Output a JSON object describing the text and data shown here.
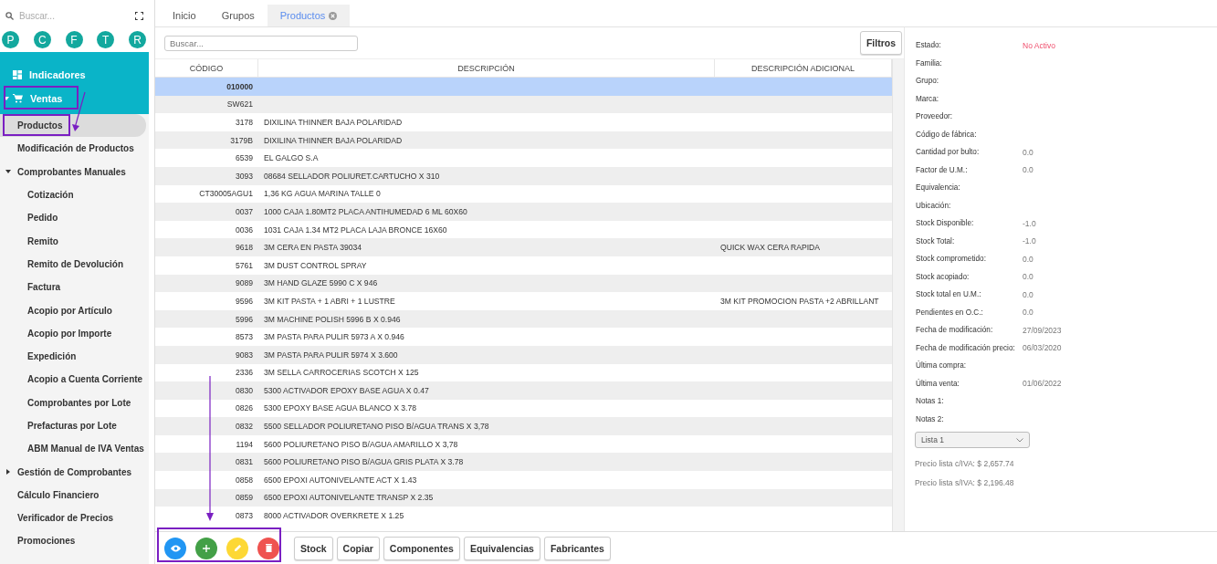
{
  "sidebar": {
    "search": {
      "placeholder": "Buscar..."
    },
    "shortcuts": [
      "P",
      "C",
      "F",
      "T",
      "R"
    ],
    "menu": [
      {
        "label": "Indicadores",
        "selected": false
      },
      {
        "label": "Ventas",
        "expanded": true,
        "selected": false,
        "children": [
          {
            "label": "Productos",
            "selected": true
          },
          {
            "label": "Modificación de Productos",
            "selected": false
          },
          {
            "label": "Comprobantes Manuales",
            "expanded": true,
            "selected": false,
            "children": [
              {
                "label": "Cotización",
                "selected": false
              },
              {
                "label": "Pedido",
                "selected": false
              },
              {
                "label": "Remito",
                "selected": false
              },
              {
                "label": "Remito de Devolución",
                "selected": false
              },
              {
                "label": "Factura",
                "selected": false
              },
              {
                "label": "Acopio por Artículo",
                "selected": false
              },
              {
                "label": "Acopio por Importe",
                "selected": false
              },
              {
                "label": "Expedición",
                "selected": false
              },
              {
                "label": "Acopio a Cuenta Corriente",
                "selected": false
              },
              {
                "label": "Comprobantes por Lote",
                "selected": false
              },
              {
                "label": "Prefacturas por Lote",
                "selected": false
              },
              {
                "label": "ABM Manual de IVA Ventas",
                "selected": false
              }
            ]
          },
          {
            "label": "Gestión de Comprobantes",
            "expanded": false,
            "selected": false
          },
          {
            "label": "Cálculo Financiero",
            "selected": false
          },
          {
            "label": "Verificador de Precios",
            "selected": false
          },
          {
            "label": "Promociones",
            "selected": false
          }
        ]
      }
    ]
  },
  "tabs": [
    {
      "label": "Inicio",
      "selected": false,
      "closable": false
    },
    {
      "label": "Grupos",
      "selected": false,
      "closable": false
    },
    {
      "label": "Productos",
      "selected": true,
      "closable": true
    }
  ],
  "search": {
    "placeholder": "Buscar..."
  },
  "filters_button": "Filtros",
  "table": {
    "columns": [
      "CÓDIGO",
      "DESCRIPCIÓN",
      "DESCRIPCIÓN ADICIONAL"
    ],
    "rows": [
      {
        "code": "010000",
        "selected": true
      },
      {
        "code": "SW621",
        "selected": false
      },
      {
        "code": "3178",
        "description": "DIXILINA THINNER BAJA POLARIDAD",
        "selected": false
      },
      {
        "code": "3179B",
        "description": "DIXILINA THINNER BAJA POLARIDAD",
        "selected": false
      },
      {
        "code": "6539",
        "description": "EL GALGO S.A",
        "selected": false
      },
      {
        "code": "3093",
        "description": "08684 SELLADOR POLIURET.CARTUCHO X 310",
        "selected": false
      },
      {
        "code": "CT30005AGU1",
        "description": "1,36 KG AGUA MARINA TALLE 0",
        "selected": false
      },
      {
        "code": "0037",
        "description": "1000 CAJA 1.80MT2 PLACA ANTIHUMEDAD 6 ML 60X60",
        "selected": false
      },
      {
        "code": "0036",
        "description": "1031 CAJA 1.34 MT2 PLACA LAJA BRONCE 16X60",
        "selected": false
      },
      {
        "code": "9618",
        "description": "3M CERA EN PASTA 39034",
        "extra": "QUICK WAX CERA RAPIDA",
        "selected": false
      },
      {
        "code": "5761",
        "description": "3M DUST CONTROL SPRAY",
        "selected": false
      },
      {
        "code": "9089",
        "description": "3M HAND GLAZE 5990 C X 946",
        "selected": false
      },
      {
        "code": "9596",
        "description": "3M KIT PASTA + 1 ABRI + 1 LUSTRE",
        "extra": "3M KIT PROMOCION PASTA +2 ABRILLANT",
        "selected": false
      },
      {
        "code": "5996",
        "description": "3M MACHINE POLISH 5996 B X 0.946",
        "selected": false
      },
      {
        "code": "8573",
        "description": "3M PASTA PARA PULIR 5973 A X 0.946",
        "selected": false
      },
      {
        "code": "9083",
        "description": "3M PASTA PARA PULIR 5974 X 3.600",
        "selected": false
      },
      {
        "code": "2336",
        "description": "3M SELLA CARROCERIAS SCOTCH X 125",
        "selected": false
      },
      {
        "code": "0830",
        "description": "5300 ACTIVADOR EPOXY BASE AGUA X 0.47",
        "selected": false
      },
      {
        "code": "0826",
        "description": "5300 EPOXY BASE AGUA BLANCO X 3.78",
        "selected": false
      },
      {
        "code": "0832",
        "description": "5500 SELLADOR POLIURETANO PISO B/AGUA TRANS X 3,78",
        "selected": false
      },
      {
        "code": "1194",
        "description": "5600 POLIURETANO PISO B/AGUA AMARILLO X 3,78",
        "selected": false
      },
      {
        "code": "0831",
        "description": "5600 POLIURETANO PISO B/AGUA GRIS PLATA X 3.78",
        "selected": false
      },
      {
        "code": "0858",
        "description": "6500 EPOXI AUTONIVELANTE ACT X 1.43",
        "selected": false
      },
      {
        "code": "0859",
        "description": "6500 EPOXI AUTONIVELANTE TRANSP X 2.35",
        "selected": false
      },
      {
        "code": "0873",
        "description": "8000 ACTIVADOR OVERKRETE X 1.25",
        "selected": false
      }
    ]
  },
  "actions": [
    {
      "kind": "view"
    },
    {
      "kind": "add"
    },
    {
      "kind": "edit"
    },
    {
      "kind": "delete"
    }
  ],
  "buttons": [
    "Stock",
    "Copiar",
    "Componentes",
    "Equivalencias",
    "Fabricantes"
  ],
  "details": {
    "status": {
      "label": "Estado:",
      "value": "No Activo",
      "active": false
    },
    "fields": [
      {
        "label": "Familia:"
      },
      {
        "label": "Grupo:"
      },
      {
        "label": "Marca:"
      },
      {
        "label": "Proveedor:"
      },
      {
        "label": "Código de fábrica:"
      },
      {
        "label": "Cantidad por bulto:",
        "value": "0.0"
      },
      {
        "label": "Factor de U.M.:",
        "value": "0.0"
      },
      {
        "label": "Equivalencia:"
      },
      {
        "label": "Ubicación:"
      },
      {
        "label": "Stock Disponible:",
        "value": "-1.0"
      },
      {
        "label": "Stock Total:",
        "value": "-1.0"
      },
      {
        "label": "Stock comprometido:",
        "value": "0.0"
      },
      {
        "label": "Stock acopiado:",
        "value": "0.0"
      },
      {
        "label": "Stock total en U.M.:",
        "value": "0.0"
      },
      {
        "label": "Pendientes en O.C.:",
        "value": "0.0"
      },
      {
        "label": "Fecha de modificación:",
        "value": "27/09/2023"
      },
      {
        "label": "Fecha de modificación precio:",
        "value": "06/03/2020"
      },
      {
        "label": "Última compra:"
      },
      {
        "label": "Última venta:",
        "value": "01/06/2022"
      },
      {
        "label": "Notas 1:"
      },
      {
        "label": "Notas 2:"
      }
    ],
    "price_list": "Lista 1",
    "prices": [
      "Precio lista c/IVA: $ 2,657.74",
      "Precio lista s/IVA: $ 2,196.48"
    ]
  }
}
